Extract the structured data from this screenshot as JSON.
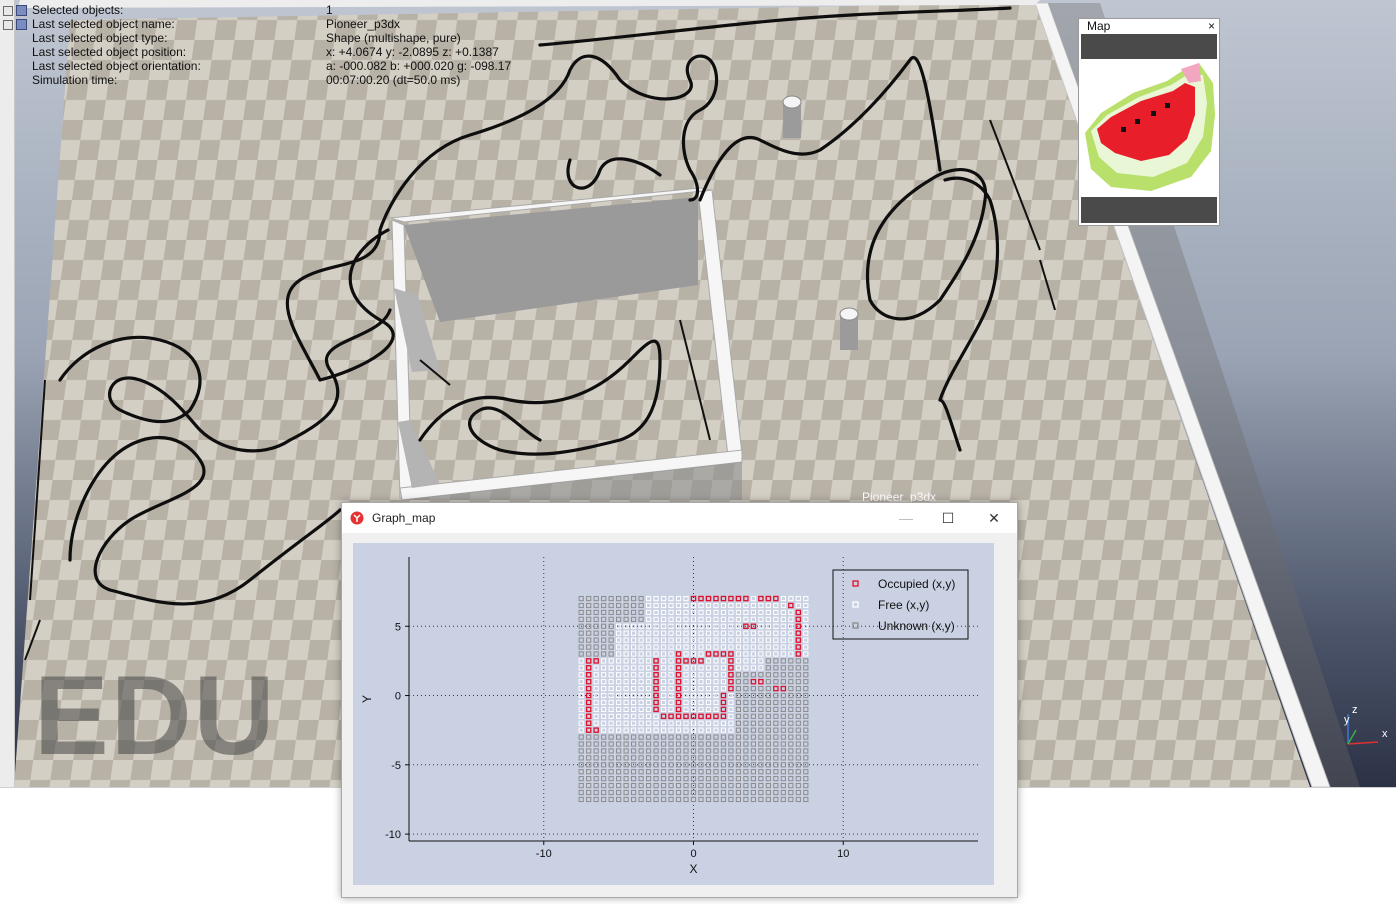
{
  "info_panel": {
    "rows": [
      {
        "key": "Selected objects:",
        "value": "1"
      },
      {
        "key": "Last selected object name:",
        "value": "Pioneer_p3dx"
      },
      {
        "key": "Last selected object type:",
        "value": "Shape (multishape, pure)"
      },
      {
        "key": "Last selected object position:",
        "value": "x: +4.0674   y: -2.0895   z: +0.1387"
      },
      {
        "key": "Last selected object orientation:",
        "value": "a: -000.082   b: +000.020   g: -098.17"
      },
      {
        "key": "Simulation time:",
        "value": "00:07:00.20 (dt=50.0 ms)"
      }
    ]
  },
  "scene": {
    "watermark": "EDU",
    "robot_label": "Pioneer_p3dx",
    "axes": {
      "x": "x",
      "y": "y",
      "z": "z"
    }
  },
  "map_window": {
    "title": "Map",
    "close": "×"
  },
  "graph_window": {
    "title": "Graph_map",
    "minimize": "—",
    "maximize": "☐",
    "close": "✕"
  },
  "chart_data": {
    "type": "scatter",
    "title": "",
    "xlabel": "X",
    "ylabel": "Y",
    "xlim": [
      -19,
      19
    ],
    "ylim": [
      -10.5,
      10
    ],
    "xticks": [
      -10,
      0,
      10
    ],
    "yticks": [
      5,
      0,
      -5,
      -10
    ],
    "grid": true,
    "legend_position": "top-right",
    "colors": {
      "occupied": "#e0102a",
      "free": "#ffffff",
      "unknown": "#8c8c8c",
      "plot_bg": "#c9d1e3"
    },
    "grid_spacing": 0.5,
    "series": [
      {
        "name": "Occupied (x,y)",
        "key": "occupied",
        "points": [
          [
            0,
            7
          ],
          [
            0.5,
            7
          ],
          [
            1,
            7
          ],
          [
            1.5,
            7
          ],
          [
            2,
            7
          ],
          [
            2.5,
            7
          ],
          [
            3,
            7
          ],
          [
            3.5,
            7
          ],
          [
            4.5,
            7
          ],
          [
            5,
            7
          ],
          [
            5.5,
            7
          ],
          [
            6.5,
            6.5
          ],
          [
            7,
            6
          ],
          [
            7,
            5.5
          ],
          [
            7,
            5
          ],
          [
            7,
            4.5
          ],
          [
            7,
            4
          ],
          [
            7,
            3.5
          ],
          [
            7,
            3
          ],
          [
            3.5,
            5
          ],
          [
            4,
            5
          ],
          [
            -7,
            2.5
          ],
          [
            -7,
            2
          ],
          [
            -7,
            1.5
          ],
          [
            -7,
            1
          ],
          [
            -7,
            0.5
          ],
          [
            -7,
            0
          ],
          [
            -7,
            -0.5
          ],
          [
            -7,
            -1
          ],
          [
            -7,
            -1.5
          ],
          [
            -7,
            -2
          ],
          [
            -7,
            -2.5
          ],
          [
            -6.5,
            2.5
          ],
          [
            -6.5,
            -2.5
          ],
          [
            -2.5,
            2.5
          ],
          [
            -2.5,
            2
          ],
          [
            -2.5,
            1.5
          ],
          [
            -2.5,
            1
          ],
          [
            -2.5,
            0.5
          ],
          [
            -2.5,
            0
          ],
          [
            -2.5,
            -0.5
          ],
          [
            -2.5,
            -1
          ],
          [
            -2,
            -1.5
          ],
          [
            -1.5,
            -1.5
          ],
          [
            -1,
            -1.5
          ],
          [
            -0.5,
            -1.5
          ],
          [
            0,
            -1.5
          ],
          [
            0.5,
            -1.5
          ],
          [
            1,
            -1.5
          ],
          [
            1.5,
            -1.5
          ],
          [
            2,
            -1.5
          ],
          [
            -1,
            3
          ],
          [
            -1,
            2.5
          ],
          [
            -1,
            2
          ],
          [
            -1,
            1.5
          ],
          [
            -1,
            1
          ],
          [
            -1,
            0.5
          ],
          [
            -1,
            0
          ],
          [
            -1,
            -0.5
          ],
          [
            -1,
            -1
          ],
          [
            0,
            2.5
          ],
          [
            0.5,
            2.5
          ],
          [
            1,
            3
          ],
          [
            1.5,
            3
          ],
          [
            2,
            3
          ],
          [
            2.5,
            3
          ],
          [
            2.5,
            2.5
          ],
          [
            2.5,
            2
          ],
          [
            2.5,
            1.5
          ],
          [
            2.5,
            1
          ],
          [
            2.5,
            0.5
          ],
          [
            2,
            0
          ],
          [
            2,
            -0.5
          ],
          [
            2,
            -1
          ],
          [
            -0.5,
            2.5
          ],
          [
            4,
            1
          ],
          [
            4.5,
            1
          ],
          [
            5.5,
            0.5
          ],
          [
            6,
            0.5
          ]
        ]
      },
      {
        "name": "Free (x,y)",
        "key": "free"
      },
      {
        "name": "Unknown (x,y)",
        "key": "unknown"
      }
    ]
  }
}
